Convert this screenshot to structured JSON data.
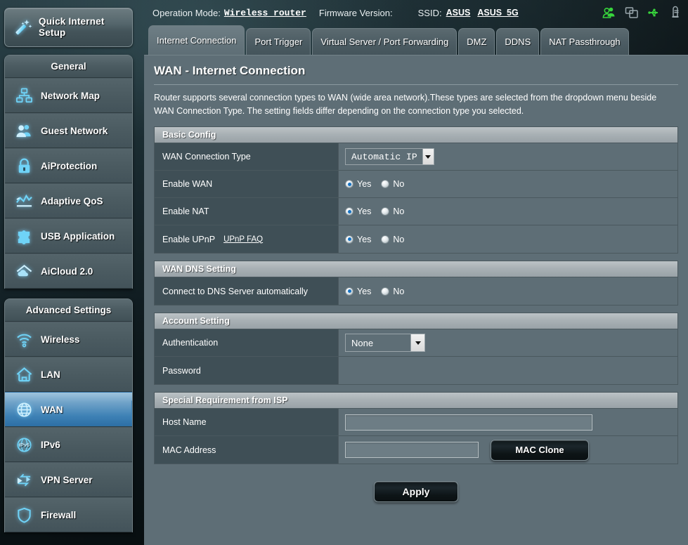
{
  "header": {
    "operation_mode_label": "Operation Mode:",
    "operation_mode_value": "Wireless router",
    "firmware_label": "Firmware Version:",
    "firmware_value": "",
    "ssid_label": "SSID:",
    "ssid_24": "ASUS",
    "ssid_5g": "ASUS_5G",
    "icons": [
      {
        "name": "clients-icon",
        "color": "#37d43c"
      },
      {
        "name": "devices-icon",
        "color": "#9aa7ad"
      },
      {
        "name": "usb-icon",
        "color": "#37d43c"
      },
      {
        "name": "printer-icon",
        "color": "#9aa7ad"
      }
    ]
  },
  "quick_setup": {
    "label": "Quick Internet Setup",
    "icon": "magic-wand-icon"
  },
  "sidebar": {
    "general": {
      "title": "General",
      "items": [
        {
          "label": "Network Map",
          "icon": "network-map-icon"
        },
        {
          "label": "Guest Network",
          "icon": "guest-network-icon"
        },
        {
          "label": "AiProtection",
          "icon": "lock-icon"
        },
        {
          "label": "Adaptive QoS",
          "icon": "chart-icon"
        },
        {
          "label": "USB Application",
          "icon": "puzzle-icon"
        },
        {
          "label": "AiCloud 2.0",
          "icon": "cloud-home-icon"
        }
      ]
    },
    "advanced": {
      "title": "Advanced Settings",
      "items": [
        {
          "label": "Wireless",
          "icon": "wifi-icon",
          "active": false
        },
        {
          "label": "LAN",
          "icon": "home-icon",
          "active": false
        },
        {
          "label": "WAN",
          "icon": "globe-icon",
          "active": true
        },
        {
          "label": "IPv6",
          "icon": "ipv6-globe-icon",
          "active": false
        },
        {
          "label": "VPN Server",
          "icon": "vpn-arrows-icon",
          "active": false
        },
        {
          "label": "Firewall",
          "icon": "shield-icon",
          "active": false
        }
      ]
    }
  },
  "tabs": [
    {
      "label": "Internet Connection",
      "active": true
    },
    {
      "label": "Port Trigger",
      "active": false
    },
    {
      "label": "Virtual Server / Port Forwarding",
      "active": false
    },
    {
      "label": "DMZ",
      "active": false
    },
    {
      "label": "DDNS",
      "active": false
    },
    {
      "label": "NAT Passthrough",
      "active": false
    }
  ],
  "page": {
    "title": "WAN - Internet Connection",
    "description": "Router supports several connection types to WAN (wide area network).These types are selected from the dropdown menu beside WAN Connection Type. The setting fields differ depending on the connection type you selected."
  },
  "basic_config": {
    "title": "Basic Config",
    "wan_connection_type": {
      "label": "WAN Connection Type",
      "value": "Automatic IP"
    },
    "enable_wan": {
      "label": "Enable WAN",
      "yes_label": "Yes",
      "no_label": "No",
      "selected": "Yes"
    },
    "enable_nat": {
      "label": "Enable NAT",
      "yes_label": "Yes",
      "no_label": "No",
      "selected": "Yes"
    },
    "enable_upnp": {
      "label": "Enable UPnP",
      "faq_link": "UPnP FAQ",
      "yes_label": "Yes",
      "no_label": "No",
      "selected": "Yes"
    }
  },
  "wan_dns": {
    "title": "WAN DNS Setting",
    "connect_auto": {
      "label": "Connect to DNS Server automatically",
      "yes_label": "Yes",
      "no_label": "No",
      "selected": "Yes"
    }
  },
  "account_setting": {
    "title": "Account Setting",
    "authentication": {
      "label": "Authentication",
      "value": "None"
    },
    "password": {
      "label": "Password",
      "value": ""
    }
  },
  "isp": {
    "title": "Special Requirement from ISP",
    "host_name": {
      "label": "Host Name",
      "value": "",
      "placeholder": ""
    },
    "mac_address": {
      "label": "MAC Address",
      "value": "",
      "placeholder": "",
      "clone_button": "MAC Clone"
    }
  },
  "actions": {
    "apply": "Apply"
  }
}
